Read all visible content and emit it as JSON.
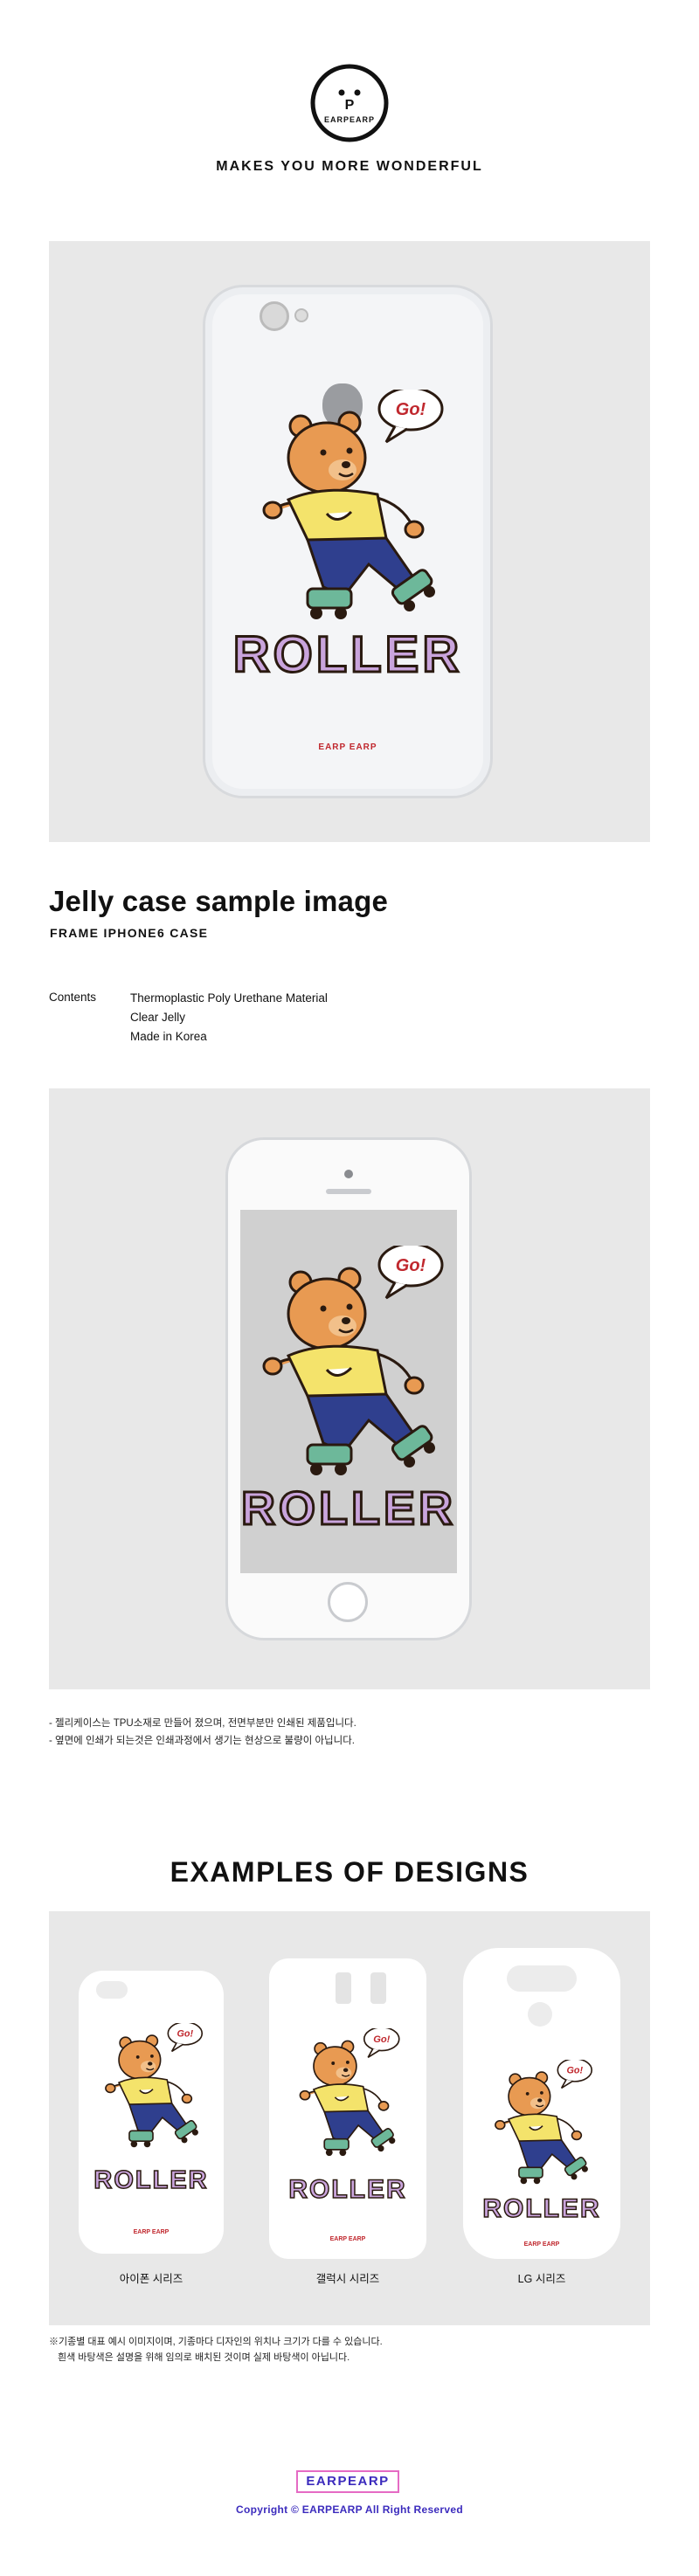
{
  "brand": {
    "logo_text": "EARPEARP",
    "logo_letter": "P",
    "tagline": "MAKES YOU MORE WONDERFUL"
  },
  "artwork": {
    "speech": "Go!",
    "word": "ROLLER",
    "case_print": "EARP EARP"
  },
  "product": {
    "title": "Jelly case sample image",
    "subtitle": "FRAME IPHONE6 CASE",
    "contents_label": "Contents",
    "contents": [
      "Thermoplastic Poly Urethane Material",
      "Clear Jelly",
      "Made in Korea"
    ]
  },
  "notes": [
    "- 젤리케이스는 TPU소재로 만들어 졌으며, 전면부분만 인쇄된 제품입니다.",
    "- 옆면에 인쇄가 되는것은 인쇄과정에서 생기는 현상으로 불량이 아닙니다."
  ],
  "examples": {
    "title": "EXAMPLES OF DESIGNS",
    "captions": [
      "아이폰 시리즈",
      "갤럭시 시리즈",
      "LG 시리즈"
    ],
    "footnote_1": "※기종별 대표 예시 이미지이며, 기종마다 디자인의 위치나 크기가 다를 수 있습니다.",
    "footnote_2": "흰색 바탕색은 설명을 위해 임의로 배치된 것이며 실제 바탕색이 아닙니다."
  },
  "footer": {
    "brand": "EARPEARP",
    "copyright": "Copyright © EARPEARP All Right Reserved"
  },
  "colors": {
    "panel_bg": "#e8e8e8",
    "bear_body": "#e89a52",
    "shirt": "#f4e36b",
    "pants": "#2f3f8e",
    "skate": "#6db89a",
    "roller_letters": "#c9a4dc",
    "brand_blue": "#3b2bbd",
    "brand_pink": "#e56bc4"
  }
}
